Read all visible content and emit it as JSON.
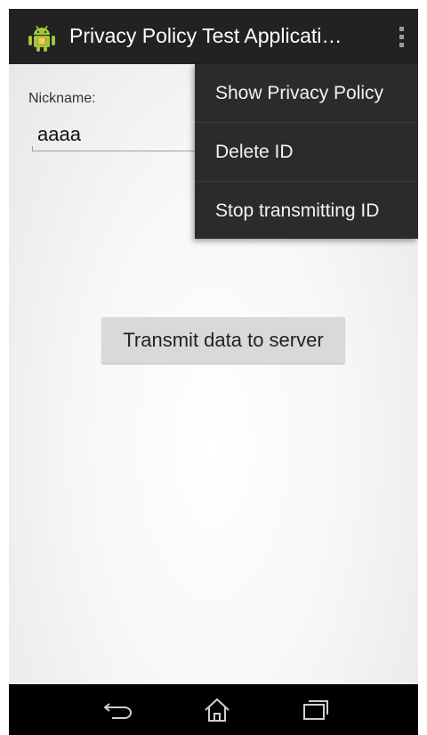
{
  "action_bar": {
    "icon": "android-icon",
    "title": "Privacy Policy Test Applicati…",
    "overflow_icon": "overflow-menu-icon"
  },
  "form": {
    "nickname_label": "Nickname:",
    "nickname_value": "aaaa"
  },
  "transmit_button": {
    "label": "Transmit data to server"
  },
  "overflow_menu": {
    "items": [
      {
        "label": "Show Privacy Policy"
      },
      {
        "label": "Delete ID"
      },
      {
        "label": "Stop transmitting ID"
      }
    ]
  },
  "nav_bar": {
    "back_icon": "back-icon",
    "home_icon": "home-icon",
    "recents_icon": "recents-icon"
  },
  "colors": {
    "action_bar_bg": "#222222",
    "menu_bg": "#2b2b2b",
    "android_green": "#a4c639",
    "nav_bar_bg": "#000000"
  }
}
